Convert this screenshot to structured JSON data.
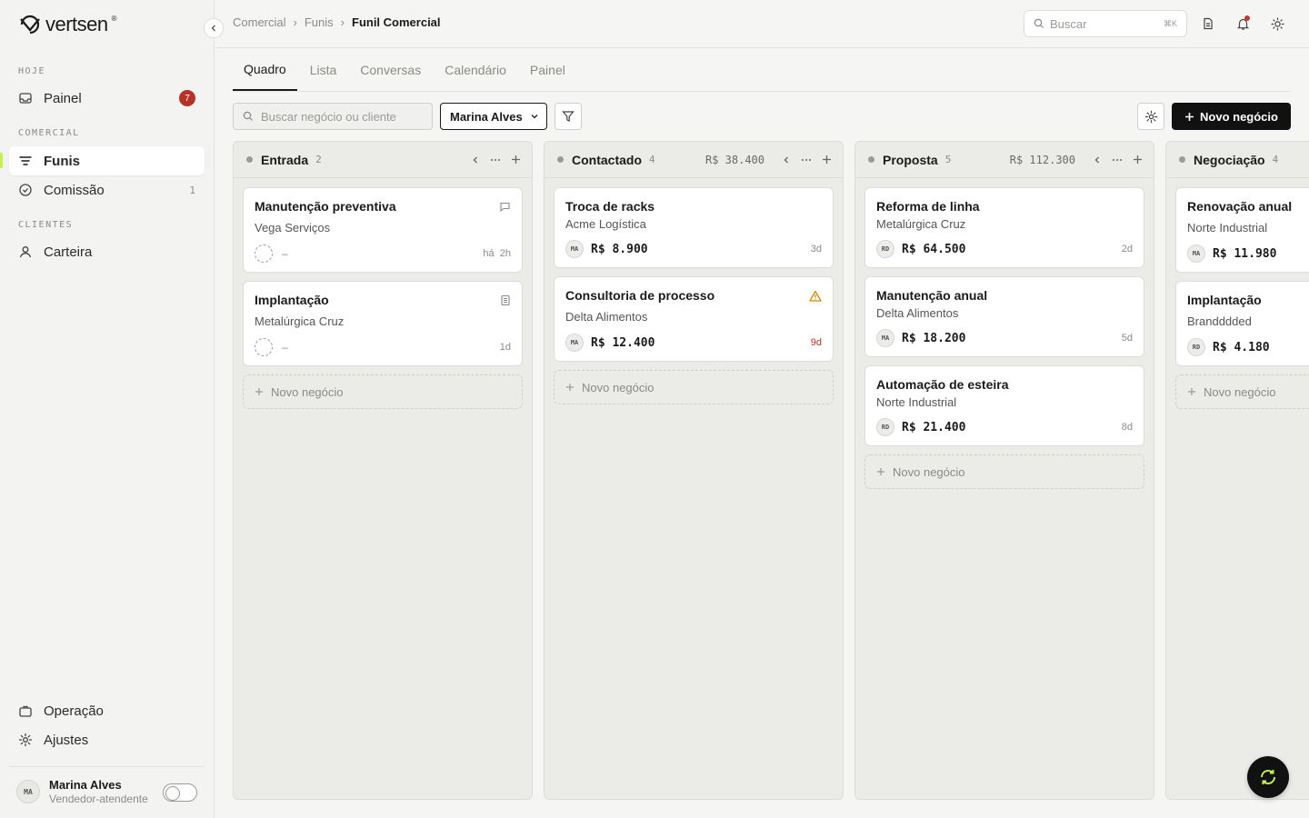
{
  "brand": {
    "name": "vertsen",
    "mark": "®"
  },
  "sidebar": {
    "sections": [
      {
        "label": "HOJE"
      },
      {
        "label": "COMERCIAL"
      },
      {
        "label": "CLIENTES"
      }
    ],
    "items": [
      {
        "label": "Painel",
        "icon": "inbox-icon",
        "badge": "7"
      },
      {
        "label": "Funis",
        "icon": "filter-lines-icon",
        "active": true
      },
      {
        "label": "Comissão",
        "icon": "check-circle-icon",
        "count": "1"
      },
      {
        "label": "Carteira",
        "icon": "user-icon"
      }
    ],
    "footer_items": [
      {
        "label": "Operação",
        "icon": "briefcase-icon"
      },
      {
        "label": "Ajustes",
        "icon": "gear-icon"
      }
    ],
    "user": {
      "initials": "MA",
      "name": "Marina Alves",
      "role": "Vendedor-atendente",
      "toggle_on": false
    }
  },
  "topbar": {
    "breadcrumb": [
      "Comercial",
      "Funis",
      "Funil Comercial"
    ],
    "search_placeholder": "Buscar",
    "search_shortcut": "⌘K"
  },
  "tabs": [
    {
      "label": "Quadro",
      "active": true
    },
    {
      "label": "Lista"
    },
    {
      "label": "Conversas"
    },
    {
      "label": "Calendário"
    },
    {
      "label": "Painel"
    }
  ],
  "toolbar": {
    "search_placeholder": "Buscar negócio ou cliente",
    "owner_filter": "Marina Alves",
    "new_deal_label": "Novo negócio"
  },
  "columns": [
    {
      "title": "Entrada",
      "count": "2",
      "total": "",
      "cards": [
        {
          "title": "Manutenção preventiva",
          "company": "Vega Serviços",
          "owner": "",
          "value": "–",
          "age": "há  2h",
          "icon": "chat-icon"
        },
        {
          "title": "Implantação",
          "company": "Metalúrgica Cruz",
          "owner": "",
          "value": "–",
          "age": "1d",
          "icon": "document-icon"
        }
      ],
      "add_label": "Novo negócio"
    },
    {
      "title": "Contactado",
      "count": "4",
      "total": "R$ 38.400",
      "cards": [
        {
          "title": "Troca de racks",
          "company": "Acme Logística",
          "owner": "MA",
          "value": "R$ 8.900",
          "age": "3d"
        },
        {
          "title": "Consultoria de processo",
          "company": "Delta Alimentos",
          "owner": "MA",
          "value": "R$ 12.400",
          "age": "9d",
          "late": true,
          "icon": "warning-icon"
        }
      ],
      "add_label": "Novo negócio"
    },
    {
      "title": "Proposta",
      "count": "5",
      "total": "R$ 112.300",
      "cards": [
        {
          "title": "Reforma de linha",
          "company": "Metalúrgica Cruz",
          "owner": "RD",
          "value": "R$ 64.500",
          "age": "2d"
        },
        {
          "title": "Manutenção anual",
          "company": "Delta Alimentos",
          "owner": "MA",
          "value": "R$ 18.200",
          "age": "5d"
        },
        {
          "title": "Automação de esteira",
          "company": "Norte Industrial",
          "owner": "RD",
          "value": "R$ 21.400",
          "age": "8d"
        }
      ],
      "add_label": "Novo negócio"
    },
    {
      "title": "Negociação",
      "count": "4",
      "total": "",
      "cards": [
        {
          "title": "Renovação anual",
          "company": "Norte Industrial",
          "owner": "MA",
          "value": "R$ 11.980",
          "age": ""
        },
        {
          "title": "Implantação",
          "company": "Brandddded",
          "owner": "RD",
          "value": "R$ 4.180",
          "age": ""
        }
      ],
      "add_label": "Novo negócio"
    }
  ],
  "colors": {
    "accent": "#c6f04a",
    "badge": "#b3322a",
    "warning": "#d08a00",
    "primary_button": "#111111"
  }
}
